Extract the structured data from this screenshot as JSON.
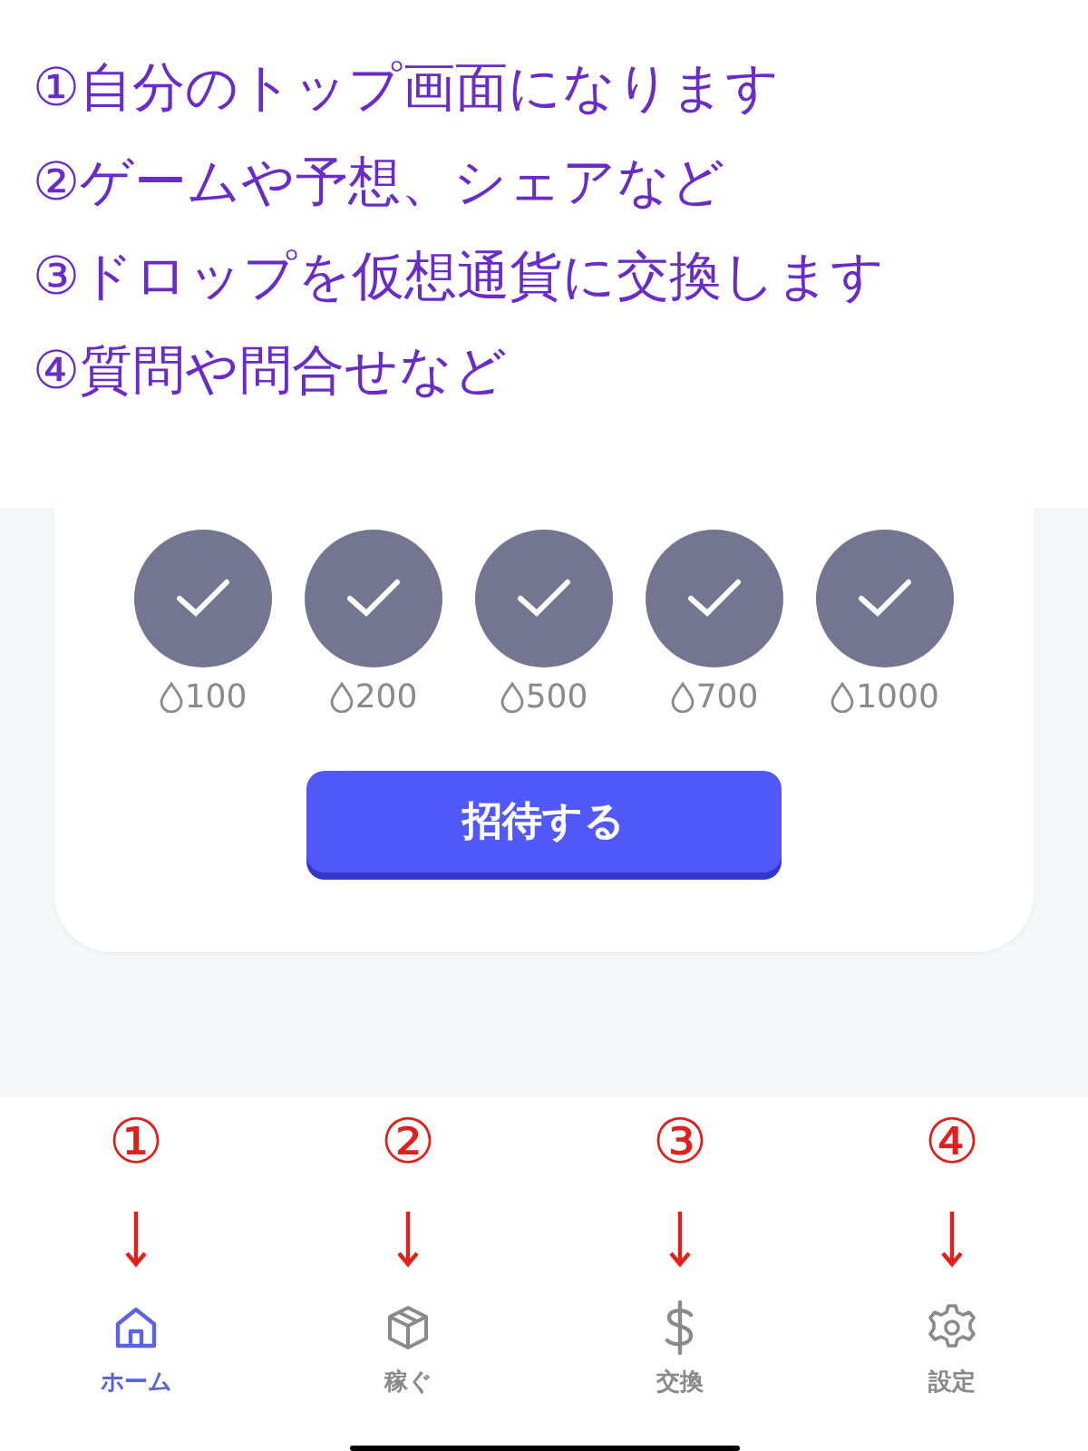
{
  "notes": [
    "①自分のトップ画面になります",
    "②ゲームや予想、シェアなど",
    "③ドロップを仮想通貨に交換します",
    "④質問や問合せなど"
  ],
  "rewards": [
    {
      "amount": "100",
      "claimed": true
    },
    {
      "amount": "200",
      "claimed": true
    },
    {
      "amount": "500",
      "claimed": true
    },
    {
      "amount": "700",
      "claimed": true
    },
    {
      "amount": "1000",
      "claimed": true
    }
  ],
  "invite_button": "招待する",
  "tabs": [
    {
      "callout": "①",
      "kind": "home",
      "label": "ホーム",
      "selected": true
    },
    {
      "callout": "②",
      "kind": "box",
      "label": "稼ぐ",
      "selected": false
    },
    {
      "callout": "③",
      "kind": "dollar",
      "label": "交換",
      "selected": false
    },
    {
      "callout": "④",
      "kind": "gear",
      "label": "設定",
      "selected": false
    }
  ]
}
